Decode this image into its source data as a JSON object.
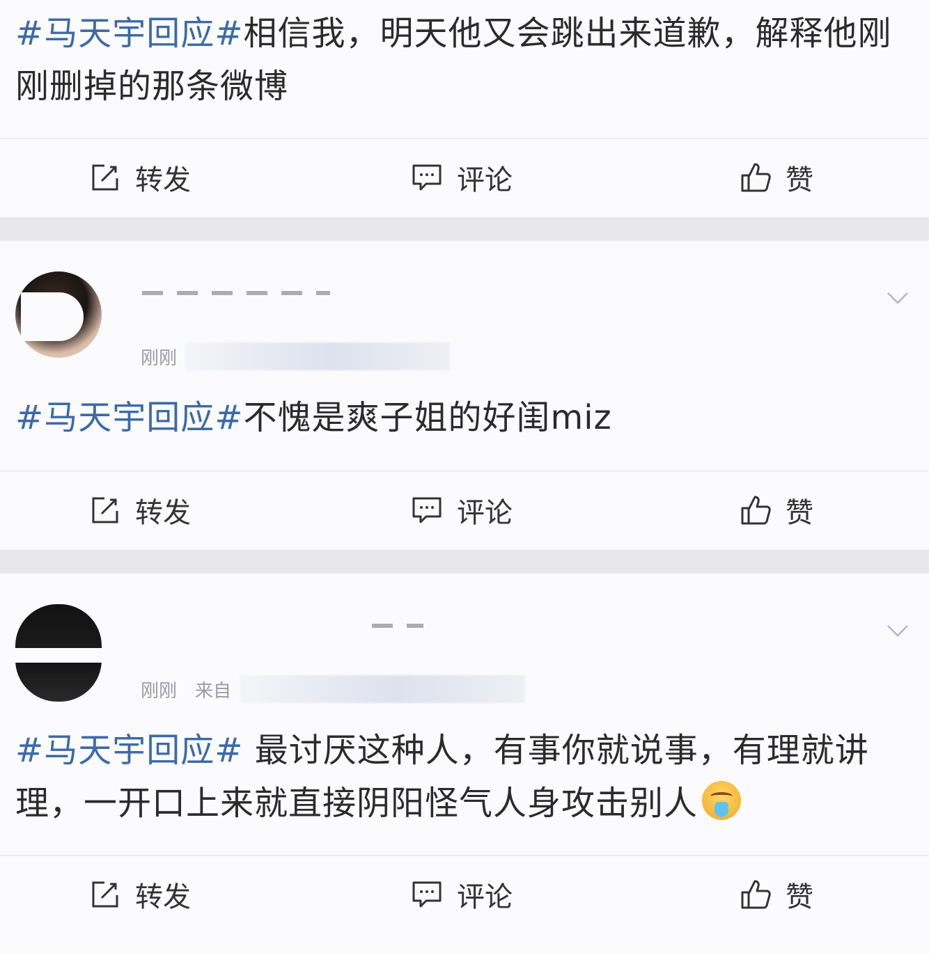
{
  "posts": [
    {
      "hashtag": "#马天宇回应#",
      "text": "相信我，明天他又会跳出来道歉，解释他刚刚删掉的那条微博",
      "emoji": ""
    },
    {
      "time": "刚刚",
      "source_prefix": "",
      "hashtag": "#马天宇回应#",
      "text": "不愧是爽子姐的好闺miz",
      "emoji": ""
    },
    {
      "time": "刚刚",
      "source_prefix": "来自",
      "hashtag": "#马天宇回应#",
      "text": " 最讨厌这种人，有事你就说事，有理就讲理，一开口上来就直接阴阳怪气人身攻击别人",
      "emoji": "puking-face-emoji"
    }
  ],
  "actions": {
    "repost": "转发",
    "comment": "评论",
    "like": "赞"
  },
  "icons": {
    "repost": "repost-icon",
    "comment": "comment-icon",
    "like": "thumbs-up-icon",
    "more": "chevron-down-icon"
  },
  "colors": {
    "hashtag": "#3c6aa8",
    "background": "#fbfbfd",
    "separator": "#e8e8ec"
  }
}
